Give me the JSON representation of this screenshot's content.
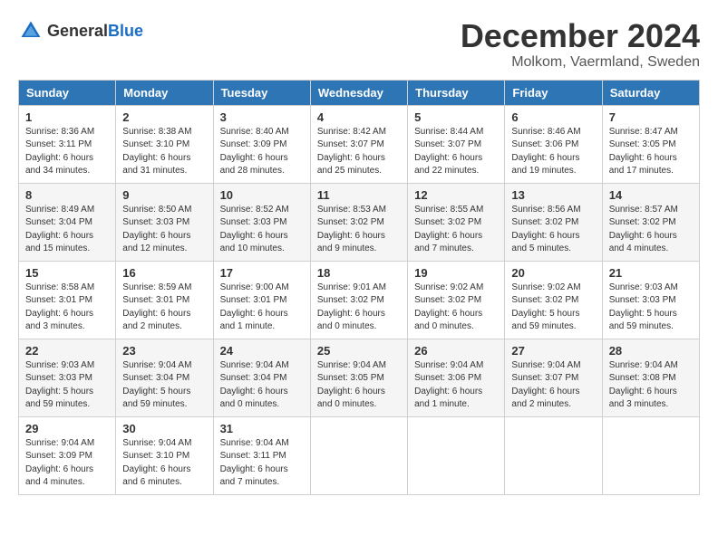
{
  "header": {
    "logo_general": "General",
    "logo_blue": "Blue",
    "title": "December 2024",
    "location": "Molkom, Vaermland, Sweden"
  },
  "days_of_week": [
    "Sunday",
    "Monday",
    "Tuesday",
    "Wednesday",
    "Thursday",
    "Friday",
    "Saturday"
  ],
  "weeks": [
    [
      {
        "day": "1",
        "sunrise": "8:36 AM",
        "sunset": "3:11 PM",
        "daylight": "6 hours and 34 minutes."
      },
      {
        "day": "2",
        "sunrise": "8:38 AM",
        "sunset": "3:10 PM",
        "daylight": "6 hours and 31 minutes."
      },
      {
        "day": "3",
        "sunrise": "8:40 AM",
        "sunset": "3:09 PM",
        "daylight": "6 hours and 28 minutes."
      },
      {
        "day": "4",
        "sunrise": "8:42 AM",
        "sunset": "3:07 PM",
        "daylight": "6 hours and 25 minutes."
      },
      {
        "day": "5",
        "sunrise": "8:44 AM",
        "sunset": "3:07 PM",
        "daylight": "6 hours and 22 minutes."
      },
      {
        "day": "6",
        "sunrise": "8:46 AM",
        "sunset": "3:06 PM",
        "daylight": "6 hours and 19 minutes."
      },
      {
        "day": "7",
        "sunrise": "8:47 AM",
        "sunset": "3:05 PM",
        "daylight": "6 hours and 17 minutes."
      }
    ],
    [
      {
        "day": "8",
        "sunrise": "8:49 AM",
        "sunset": "3:04 PM",
        "daylight": "6 hours and 15 minutes."
      },
      {
        "day": "9",
        "sunrise": "8:50 AM",
        "sunset": "3:03 PM",
        "daylight": "6 hours and 12 minutes."
      },
      {
        "day": "10",
        "sunrise": "8:52 AM",
        "sunset": "3:03 PM",
        "daylight": "6 hours and 10 minutes."
      },
      {
        "day": "11",
        "sunrise": "8:53 AM",
        "sunset": "3:02 PM",
        "daylight": "6 hours and 9 minutes."
      },
      {
        "day": "12",
        "sunrise": "8:55 AM",
        "sunset": "3:02 PM",
        "daylight": "6 hours and 7 minutes."
      },
      {
        "day": "13",
        "sunrise": "8:56 AM",
        "sunset": "3:02 PM",
        "daylight": "6 hours and 5 minutes."
      },
      {
        "day": "14",
        "sunrise": "8:57 AM",
        "sunset": "3:02 PM",
        "daylight": "6 hours and 4 minutes."
      }
    ],
    [
      {
        "day": "15",
        "sunrise": "8:58 AM",
        "sunset": "3:01 PM",
        "daylight": "6 hours and 3 minutes."
      },
      {
        "day": "16",
        "sunrise": "8:59 AM",
        "sunset": "3:01 PM",
        "daylight": "6 hours and 2 minutes."
      },
      {
        "day": "17",
        "sunrise": "9:00 AM",
        "sunset": "3:01 PM",
        "daylight": "6 hours and 1 minute."
      },
      {
        "day": "18",
        "sunrise": "9:01 AM",
        "sunset": "3:02 PM",
        "daylight": "6 hours and 0 minutes."
      },
      {
        "day": "19",
        "sunrise": "9:02 AM",
        "sunset": "3:02 PM",
        "daylight": "6 hours and 0 minutes."
      },
      {
        "day": "20",
        "sunrise": "9:02 AM",
        "sunset": "3:02 PM",
        "daylight": "5 hours and 59 minutes."
      },
      {
        "day": "21",
        "sunrise": "9:03 AM",
        "sunset": "3:03 PM",
        "daylight": "5 hours and 59 minutes."
      }
    ],
    [
      {
        "day": "22",
        "sunrise": "9:03 AM",
        "sunset": "3:03 PM",
        "daylight": "5 hours and 59 minutes."
      },
      {
        "day": "23",
        "sunrise": "9:04 AM",
        "sunset": "3:04 PM",
        "daylight": "5 hours and 59 minutes."
      },
      {
        "day": "24",
        "sunrise": "9:04 AM",
        "sunset": "3:04 PM",
        "daylight": "6 hours and 0 minutes."
      },
      {
        "day": "25",
        "sunrise": "9:04 AM",
        "sunset": "3:05 PM",
        "daylight": "6 hours and 0 minutes."
      },
      {
        "day": "26",
        "sunrise": "9:04 AM",
        "sunset": "3:06 PM",
        "daylight": "6 hours and 1 minute."
      },
      {
        "day": "27",
        "sunrise": "9:04 AM",
        "sunset": "3:07 PM",
        "daylight": "6 hours and 2 minutes."
      },
      {
        "day": "28",
        "sunrise": "9:04 AM",
        "sunset": "3:08 PM",
        "daylight": "6 hours and 3 minutes."
      }
    ],
    [
      {
        "day": "29",
        "sunrise": "9:04 AM",
        "sunset": "3:09 PM",
        "daylight": "6 hours and 4 minutes."
      },
      {
        "day": "30",
        "sunrise": "9:04 AM",
        "sunset": "3:10 PM",
        "daylight": "6 hours and 6 minutes."
      },
      {
        "day": "31",
        "sunrise": "9:04 AM",
        "sunset": "3:11 PM",
        "daylight": "6 hours and 7 minutes."
      },
      null,
      null,
      null,
      null
    ]
  ]
}
